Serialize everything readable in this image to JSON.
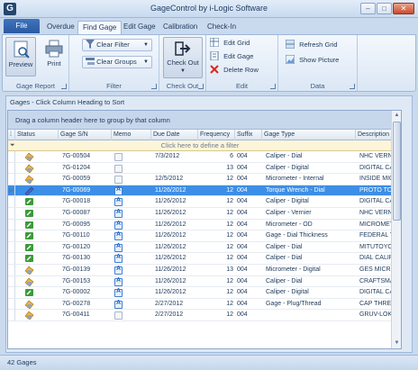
{
  "window": {
    "title": "GageControl by i-Logic Software",
    "minimize": "–",
    "maximize": "□",
    "close": "✕"
  },
  "tabs": {
    "file": "File",
    "items": [
      "Overdue",
      "Find Gage",
      "Edit Gage",
      "Calibration",
      "Check-In"
    ],
    "active": "Find Gage"
  },
  "ribbon": {
    "gage_report": {
      "label": "Gage Report",
      "preview": "Preview",
      "print": "Print"
    },
    "filter": {
      "label": "Filter",
      "clear_filter": "Clear Filter",
      "clear_groups": "Clear Groups"
    },
    "check_out": {
      "label": "Check Out",
      "check_out": "Check Out"
    },
    "edit": {
      "label": "Edit",
      "edit_grid": "Edit Grid",
      "edit_gage": "Edit Gage",
      "delete_row": "Delete Row"
    },
    "data": {
      "label": "Data",
      "refresh_grid": "Refresh Grid",
      "show_picture": "Show Picture"
    }
  },
  "grid": {
    "panel_title": "Gages - Click Column Heading to Sort",
    "group_hint": "Drag a column header here to group by that column",
    "filter_hint": "Click here to define a filter",
    "columns": [
      "Status",
      "Gage S/N",
      "Memo",
      "Due Date",
      "Frequency",
      "Suffix",
      "Gage Type",
      "Description"
    ],
    "rows": [
      {
        "status": "gray-hand",
        "sn": "7G-00504",
        "memo": "plain",
        "due": "7/3/2012",
        "freq": "6",
        "suffix": "004",
        "type": "Caliper - Dial",
        "desc": "NHC VERNIE"
      },
      {
        "status": "gray-hand",
        "sn": "7G-01204",
        "memo": "plain",
        "due": "",
        "freq": "13",
        "suffix": "004",
        "type": "Caliper - Digital",
        "desc": "DIGITAL CA"
      },
      {
        "status": "gray-hand",
        "sn": "7G-00059",
        "memo": "plain",
        "due": "12/5/2012",
        "freq": "12",
        "suffix": "004",
        "type": "Micrometer - Internal",
        "desc": "INSIDE MIC"
      },
      {
        "status": "blue-tool",
        "sn": "7G-00069",
        "memo": "a",
        "due": "11/26/2012",
        "freq": "12",
        "suffix": "004",
        "type": "Torque Wrench - Dial",
        "desc": "PROTO TOR",
        "selected": true
      },
      {
        "status": "green-gage",
        "sn": "7G-00018",
        "memo": "a",
        "due": "11/26/2012",
        "freq": "12",
        "suffix": "004",
        "type": "Caliper - Digital",
        "desc": "DIGITAL CA"
      },
      {
        "status": "green-gage",
        "sn": "7G-00087",
        "memo": "a",
        "due": "11/26/2012",
        "freq": "12",
        "suffix": "004",
        "type": "Caliper - Vernier",
        "desc": "NHC VERNIE"
      },
      {
        "status": "green-gage",
        "sn": "7G-00095",
        "memo": "a",
        "due": "11/26/2012",
        "freq": "12",
        "suffix": "004",
        "type": "Micrometer - OD",
        "desc": "MICROMETE"
      },
      {
        "status": "green-gage",
        "sn": "7G-00110",
        "memo": "a",
        "due": "11/26/2012",
        "freq": "12",
        "suffix": "004",
        "type": "Gage - Dial Thickness",
        "desc": "FEDERAL TH"
      },
      {
        "status": "green-gage",
        "sn": "7G-00120",
        "memo": "a",
        "due": "11/26/2012",
        "freq": "12",
        "suffix": "004",
        "type": "Caliper - Dial",
        "desc": "MITUTOYO"
      },
      {
        "status": "green-gage",
        "sn": "7G-00130",
        "memo": "a",
        "due": "11/26/2012",
        "freq": "12",
        "suffix": "004",
        "type": "Caliper - Dial",
        "desc": "DIAL CALIPE"
      },
      {
        "status": "gray-hand",
        "sn": "7G-00139",
        "memo": "a",
        "due": "11/26/2012",
        "freq": "13",
        "suffix": "004",
        "type": "Micrometer - Digital",
        "desc": "GES MICRO"
      },
      {
        "status": "gray-hand",
        "sn": "7G-00153",
        "memo": "a",
        "due": "11/26/2012",
        "freq": "12",
        "suffix": "004",
        "type": "Caliper - Dial",
        "desc": "CRAFTSMA"
      },
      {
        "status": "green-gage",
        "sn": "7G-00002",
        "memo": "a",
        "due": "11/26/2012",
        "freq": "12",
        "suffix": "004",
        "type": "Caliper - Digital",
        "desc": "DIGITAL CA"
      },
      {
        "status": "gray-hand",
        "sn": "7G-00278",
        "memo": "a",
        "due": "2/27/2012",
        "freq": "12",
        "suffix": "004",
        "type": "Gage - Plug/Thread",
        "desc": "CAP THREA"
      },
      {
        "status": "gray-hand",
        "sn": "7G-00411",
        "memo": "plain",
        "due": "2/27/2012",
        "freq": "12",
        "suffix": "004",
        "type": "",
        "desc": "GRUV-LOK U"
      }
    ]
  },
  "status_bar": {
    "count": "42 Gages"
  }
}
